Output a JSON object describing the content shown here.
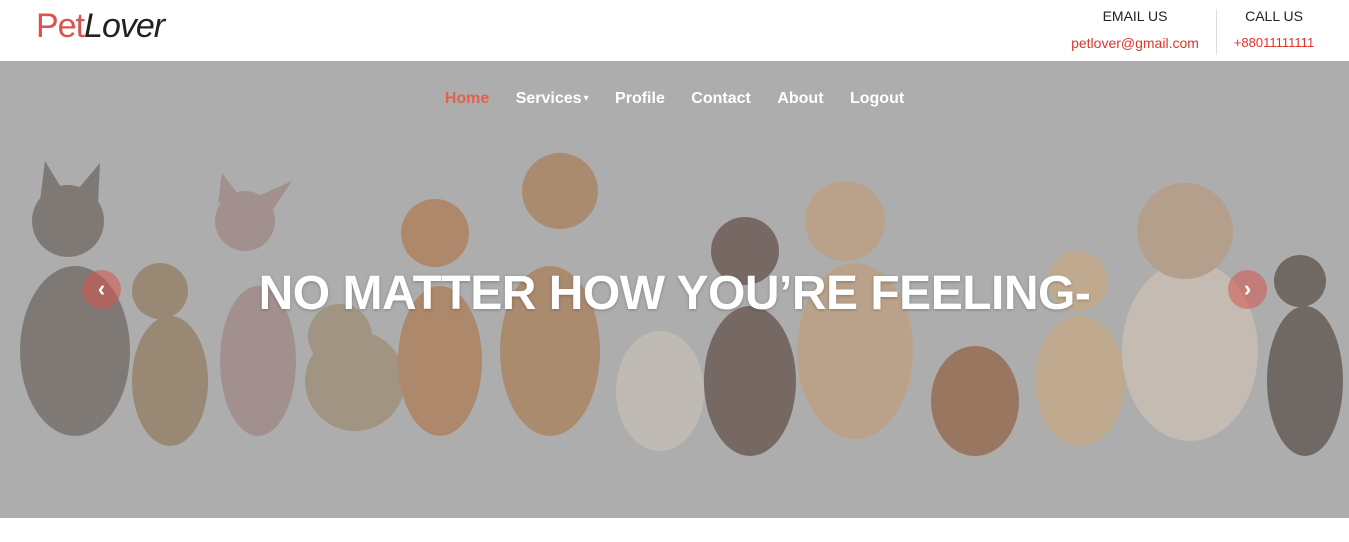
{
  "logo": {
    "part1": "Pet",
    "part2": "Lover"
  },
  "contact": {
    "email_label": "EMAIL US",
    "email_value": "petlover@gmail.com",
    "call_label": "CALL US",
    "call_value": "+88011111111"
  },
  "nav": {
    "items": [
      {
        "label": "Home",
        "active": true
      },
      {
        "label": "Services",
        "has_dropdown": true
      },
      {
        "label": "Profile"
      },
      {
        "label": "Contact"
      },
      {
        "label": "About"
      },
      {
        "label": "Logout"
      }
    ]
  },
  "hero": {
    "headline": "NO MATTER HOW YOU’RE FEELING-",
    "prev_icon": "chevron-left-icon",
    "next_icon": "chevron-right-icon",
    "prev_glyph": "‹",
    "next_glyph": "›"
  },
  "colors": {
    "accent": "#e4624a",
    "contact_red": "#e0342b",
    "hero_overlay": "#adadad",
    "text_dark": "#222222"
  }
}
